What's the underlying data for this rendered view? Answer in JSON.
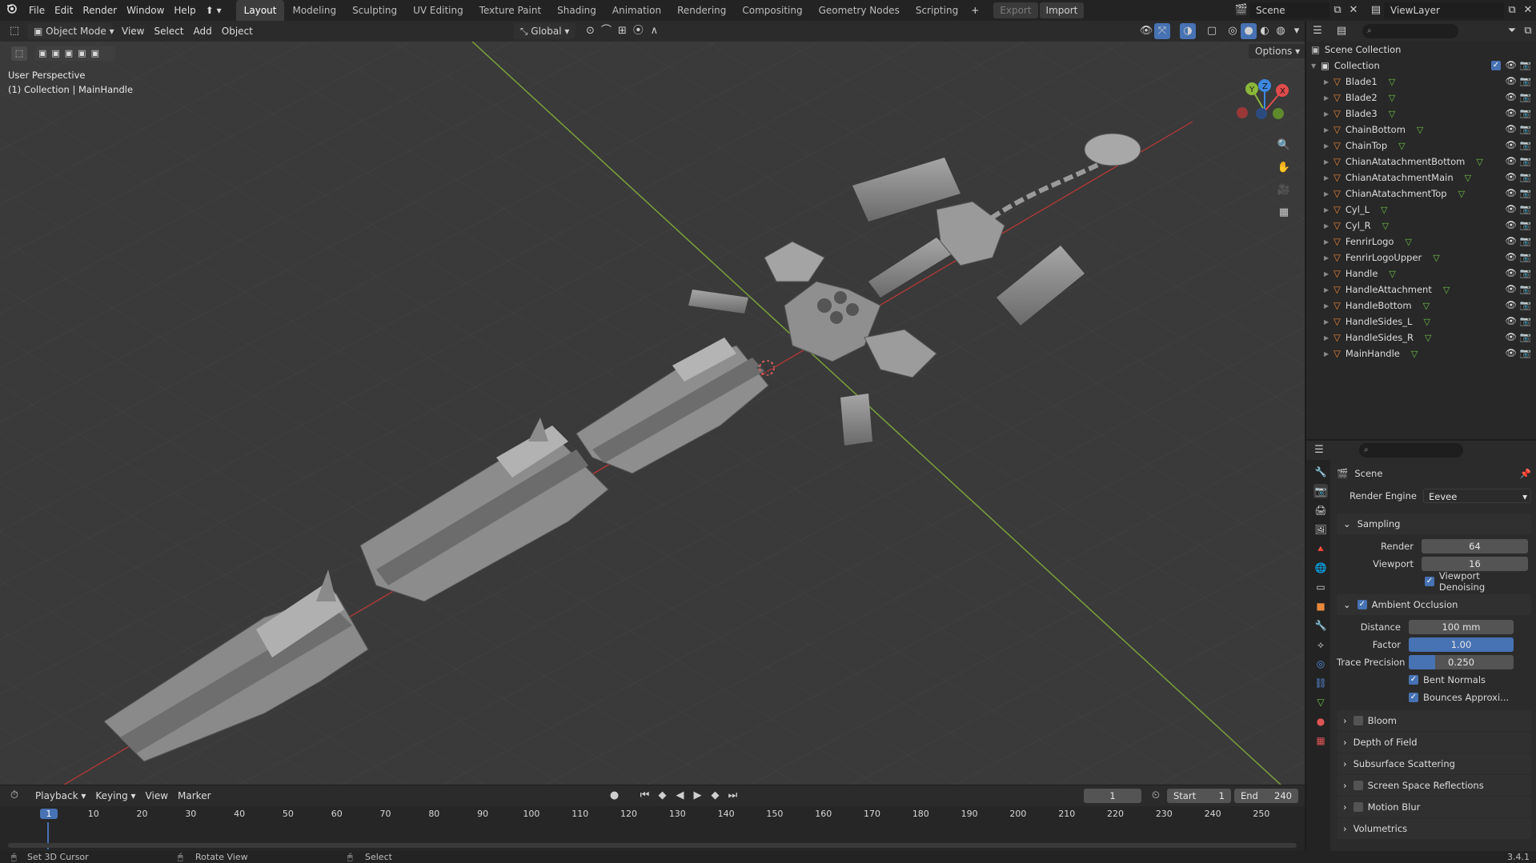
{
  "app": {
    "menus": [
      "File",
      "Edit",
      "Render",
      "Window",
      "Help"
    ],
    "workspaces": [
      "Layout",
      "Modeling",
      "Sculpting",
      "UV Editing",
      "Texture Paint",
      "Shading",
      "Animation",
      "Rendering",
      "Compositing",
      "Geometry Nodes",
      "Scripting"
    ],
    "active_workspace": "Layout",
    "export_label": "Export",
    "import_label": "Import",
    "scene_name": "Scene",
    "view_layer": "ViewLayer",
    "version": "3.4.1"
  },
  "viewport": {
    "mode": "Object Mode",
    "menus": [
      "View",
      "Select",
      "Add",
      "Object"
    ],
    "orientation": "Global",
    "options_label": "Options",
    "overlay_title": "User Perspective",
    "overlay_subtitle": "(1) Collection | MainHandle",
    "gizmo": {
      "x": "X",
      "y": "Y",
      "z": "Z"
    }
  },
  "outliner": {
    "root": "Scene Collection",
    "collection": "Collection",
    "objects": [
      "Blade1",
      "Blade2",
      "Blade3",
      "ChainBottom",
      "ChainTop",
      "ChianAtatachmentBottom",
      "ChianAtatachmentMain",
      "ChianAtatachmentTop",
      "Cyl_L",
      "Cyl_R",
      "FenrirLogo",
      "FenrirLogoUpper",
      "Handle",
      "HandleAttachment",
      "HandleBottom",
      "HandleSides_L",
      "HandleSides_R",
      "MainHandle"
    ]
  },
  "properties": {
    "context": "Scene",
    "render_engine_label": "Render Engine",
    "render_engine": "Eevee",
    "sampling": {
      "title": "Sampling",
      "render_label": "Render",
      "render": "64",
      "viewport_label": "Viewport",
      "viewport": "16",
      "denoise_label": "Viewport Denoising"
    },
    "ao": {
      "title": "Ambient Occlusion",
      "distance_label": "Distance",
      "distance": "100 mm",
      "factor_label": "Factor",
      "factor": "1.00",
      "factor_fill": 1.0,
      "trace_label": "Trace Precision",
      "trace": "0.250",
      "trace_fill": 0.25,
      "bent_label": "Bent Normals",
      "bounces_label": "Bounces Approxi..."
    },
    "panels": [
      "Bloom",
      "Depth of Field",
      "Subsurface Scattering",
      "Screen Space Reflections",
      "Motion Blur",
      "Volumetrics"
    ],
    "panels_with_checkbox": [
      true,
      false,
      false,
      true,
      true,
      false
    ]
  },
  "timeline": {
    "menus": [
      "Playback",
      "Keying",
      "View",
      "Marker"
    ],
    "current_frame": "1",
    "start_label": "Start",
    "start": "1",
    "end_label": "End",
    "end": "240",
    "ticks": [
      "1",
      "10",
      "20",
      "30",
      "40",
      "50",
      "60",
      "70",
      "80",
      "90",
      "100",
      "110",
      "120",
      "130",
      "140",
      "150",
      "160",
      "170",
      "180",
      "190",
      "200",
      "210",
      "220",
      "230",
      "240",
      "250"
    ]
  },
  "status": {
    "items": [
      "Set 3D Cursor",
      "Rotate View",
      "Select"
    ]
  },
  "colors": {
    "accent": "#4772b3",
    "x_axis": "#e04b4b",
    "y_axis": "#8bb83a",
    "z_axis": "#3d88e0",
    "mesh": "#8d8d8d",
    "object_icon": "#e8893c"
  }
}
